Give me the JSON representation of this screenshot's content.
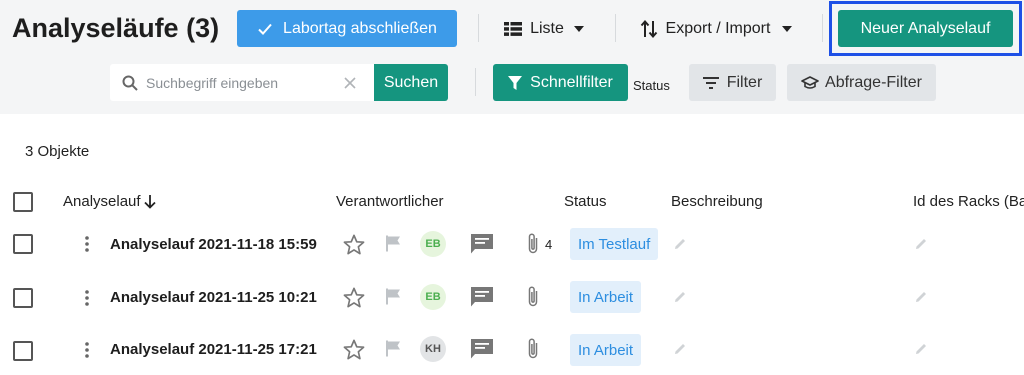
{
  "header": {
    "title": "Analyseläufe (3)",
    "finish_day_label": "Labortag abschließen",
    "list_label": "Liste",
    "export_label": "Export / Import",
    "new_run_label": "Neuer Analyselauf"
  },
  "search": {
    "placeholder": "Suchbegriff eingeben",
    "value": "",
    "button_label": "Suchen"
  },
  "filters": {
    "quick_filter_label": "Schnellfilter",
    "status_label": "Status",
    "filter_label": "Filter",
    "query_filter_label": "Abfrage-Filter"
  },
  "table": {
    "count_label": "3 Objekte",
    "columns": {
      "run": "Analyselauf",
      "owner": "Verantwortlicher",
      "status": "Status",
      "description": "Beschreibung",
      "rack_id": "Id des Racks (Ba"
    },
    "rows": [
      {
        "name": "Analyselauf 2021-11-18 15:59",
        "avatar": "EB",
        "attachments": "4",
        "status": "Im Testlauf"
      },
      {
        "name": "Analyselauf 2021-11-25 10:21",
        "avatar": "EB",
        "attachments": "",
        "status": "In Arbeit"
      },
      {
        "name": "Analyselauf 2021-11-25 17:21",
        "avatar": "KH",
        "attachments": "",
        "status": "In Arbeit"
      }
    ]
  },
  "colors": {
    "primary_green": "#15957f",
    "primary_blue": "#3d9be9",
    "highlight_border": "#1e50e6",
    "status_badge_bg": "#e2effb",
    "status_badge_text": "#2d8ee0"
  }
}
